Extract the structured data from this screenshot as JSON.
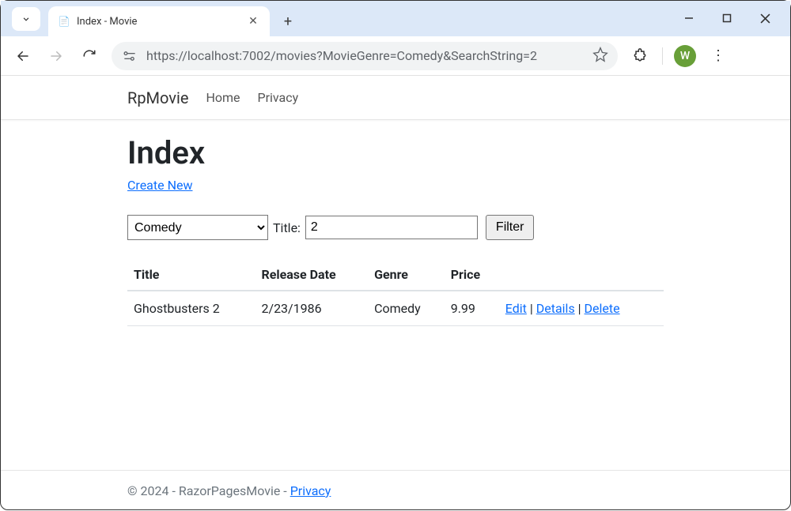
{
  "browser": {
    "tab_title": "Index - Movie",
    "url": "https://localhost:7002/movies?MovieGenre=Comedy&SearchString=2",
    "avatar_letter": "W"
  },
  "nav": {
    "brand": "RpMovie",
    "links": [
      "Home",
      "Privacy"
    ]
  },
  "page": {
    "heading": "Index",
    "create_link": "Create New",
    "filter": {
      "genre_selected": "Comedy",
      "title_label": "Title:",
      "title_value": "2",
      "button": "Filter"
    },
    "table": {
      "headers": [
        "Title",
        "Release Date",
        "Genre",
        "Price"
      ],
      "rows": [
        {
          "title": "Ghostbusters 2",
          "release_date": "2/23/1986",
          "genre": "Comedy",
          "price": "9.99"
        }
      ],
      "actions": {
        "edit": "Edit",
        "details": "Details",
        "delete": "Delete",
        "sep": " | "
      }
    }
  },
  "footer": {
    "text": "© 2024 - RazorPagesMovie - ",
    "privacy": "Privacy"
  }
}
